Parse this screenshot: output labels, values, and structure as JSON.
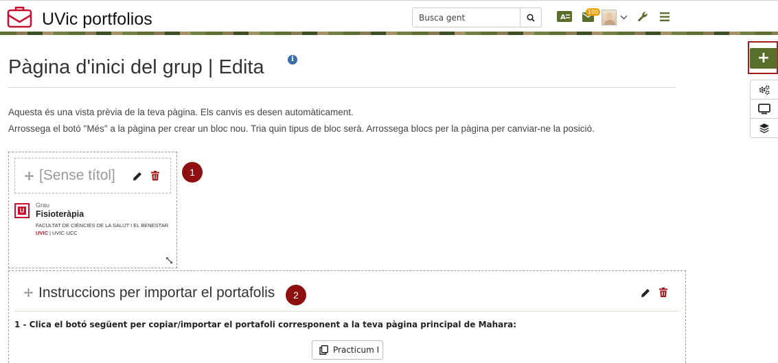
{
  "header": {
    "site_title": "UVic portfolios",
    "search_placeholder": "Busca gent",
    "notification_count": "100",
    "brand_color": "#c8102e"
  },
  "page": {
    "title": "Pàgina d'inici del grup | Edita",
    "intro_line1": "Aquesta és una vista prèvia de la teva pàgina. Els canvis es desen automàticament.",
    "intro_line2": "Arrossega el botó \"Més\" a la pàgina per crear un bloc nou. Tria quin tipus de bloc serà. Arrossega blocs per la pàgina per canviar-ne la posició."
  },
  "tools": {
    "add_label": "+",
    "accent_color": "#5a6e2c"
  },
  "blocks": [
    {
      "title": "[Sense títol]",
      "marker": "1",
      "logo": {
        "grau": "Grau",
        "name": "Fisioteràpia",
        "faculty": "FACULTAT DE CIÈNCIES DE LA SALUT I EL BENESTAR",
        "foot_brand": "UVIC",
        "foot_rest": " | UVIC·UCC"
      }
    },
    {
      "title": "Instruccions per importar el portafolis",
      "marker": "2",
      "instruction": "1 - Clica el botó següent per copiar/importar el portafoli corresponent a la teva pàgina principal de Mahara:",
      "button_label": "Practicum I"
    }
  ]
}
